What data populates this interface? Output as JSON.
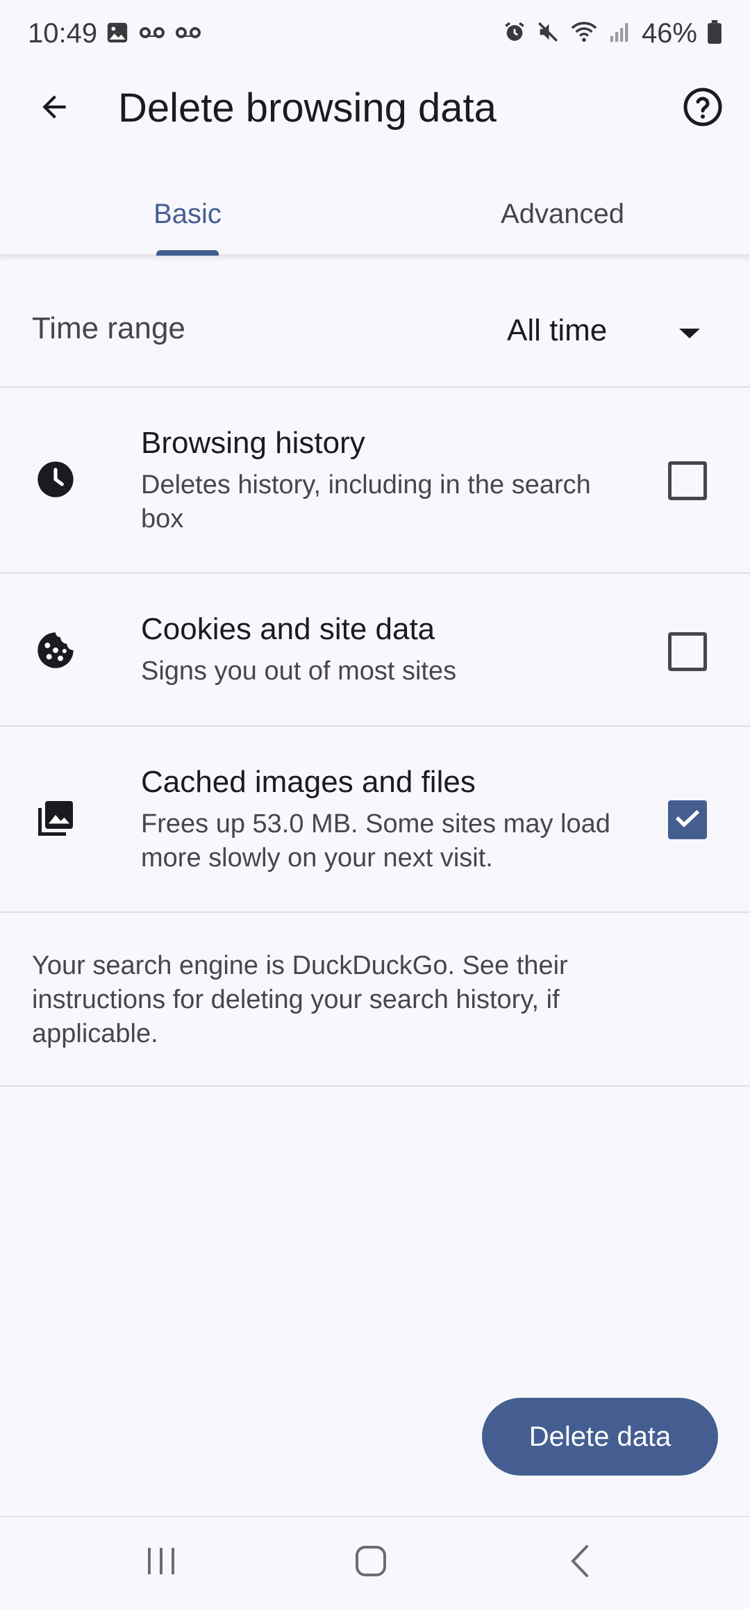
{
  "status_bar": {
    "time": "10:49",
    "battery": "46%",
    "left_icons": [
      "gallery-icon",
      "voicemail-icon",
      "voicemail-icon"
    ],
    "right_icons": [
      "alarm-icon",
      "mute-icon",
      "wifi-icon",
      "signal-icon",
      "battery-icon"
    ]
  },
  "app_bar": {
    "title": "Delete browsing data",
    "back_icon": "arrow-back-icon",
    "help_icon": "help-circle-icon"
  },
  "tabs": [
    {
      "label": "Basic",
      "selected": true
    },
    {
      "label": "Advanced",
      "selected": false
    }
  ],
  "time_range": {
    "label": "Time range",
    "value": "All time"
  },
  "options": [
    {
      "icon": "clock-icon",
      "title": "Browsing history",
      "subtitle": "Deletes history, including in the search box",
      "checked": false
    },
    {
      "icon": "cookie-icon",
      "title": "Cookies and site data",
      "subtitle": "Signs you out of most sites",
      "checked": false
    },
    {
      "icon": "image-library-icon",
      "title": "Cached images and files",
      "subtitle": "Frees up 53.0 MB. Some sites may load more slowly on your next visit.",
      "checked": true
    }
  ],
  "note": "Your search engine is DuckDuckGo. See their instructions for deleting your search history, if applicable.",
  "delete_button": "Delete data",
  "colors": {
    "accent": "#445e91",
    "background": "#f8f8fc",
    "divider": "#e0e0e4",
    "text_primary": "#1b1b1f",
    "text_secondary": "#44474f"
  }
}
